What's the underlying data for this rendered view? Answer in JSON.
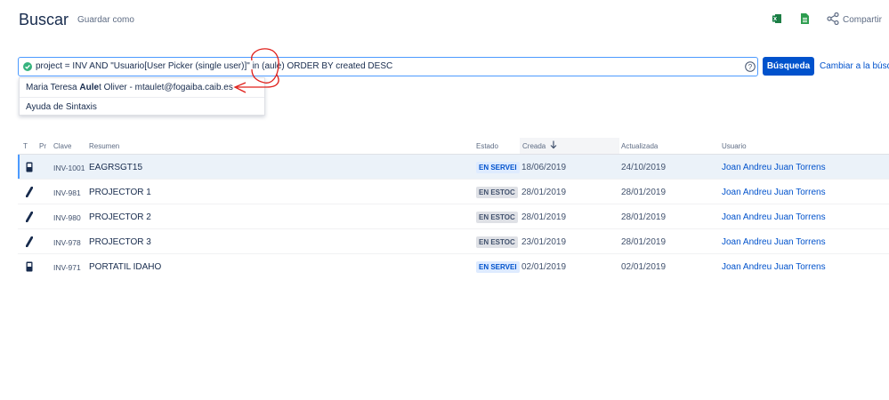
{
  "header": {
    "title": "Buscar",
    "save_as": "Guardar como",
    "share": "Compartir"
  },
  "search": {
    "query": "project = INV AND \"Usuario[User Picker (single user)]\" in (aule) ORDER BY created DESC",
    "button": "Búsqueda",
    "switch_link": "Cambiar a la búsq"
  },
  "dropdown": {
    "suggestion_prefix": "Maria Teresa ",
    "suggestion_match": "Aule",
    "suggestion_suffix": "t Oliver - mtaulet@fogaiba.caib.es",
    "syntax_help": "Ayuda de Sintaxis"
  },
  "table": {
    "columns": {
      "type": "T",
      "priority": "Pr",
      "key": "Clave",
      "summary": "Resumen",
      "status": "Estado",
      "created": "Creada",
      "updated": "Actualizada",
      "user": "Usuario"
    },
    "sort_icon": "arrow-down-icon",
    "rows": [
      {
        "type_icon": "mobile-device-icon",
        "key": "INV-1001",
        "summary": "EAGRSGT15",
        "status": "EN SERVEI",
        "created": "18/06/2019",
        "updated": "24/10/2019",
        "user": "Joan Andreu Juan Torrens"
      },
      {
        "type_icon": "projector-icon",
        "key": "INV-981",
        "summary": "PROJECTOR 1",
        "status": "EN ESTOC",
        "created": "28/01/2019",
        "updated": "28/01/2019",
        "user": "Joan Andreu Juan Torrens"
      },
      {
        "type_icon": "projector-icon",
        "key": "INV-980",
        "summary": "PROJECTOR 2",
        "status": "EN ESTOC",
        "created": "28/01/2019",
        "updated": "28/01/2019",
        "user": "Joan Andreu Juan Torrens"
      },
      {
        "type_icon": "projector-icon",
        "key": "INV-978",
        "summary": "PROJECTOR 3",
        "status": "EN ESTOC",
        "created": "23/01/2019",
        "updated": "28/01/2019",
        "user": "Joan Andreu Juan Torrens"
      },
      {
        "type_icon": "mobile-device-icon",
        "key": "INV-971",
        "summary": "PORTATIL IDAHO",
        "status": "EN SERVEI",
        "created": "02/01/2019",
        "updated": "02/01/2019",
        "user": "Joan Andreu Juan Torrens"
      }
    ]
  },
  "colors": {
    "accent": "#0052cc",
    "annotation": "#e0201b",
    "selected_row": "#ebf2f9"
  }
}
